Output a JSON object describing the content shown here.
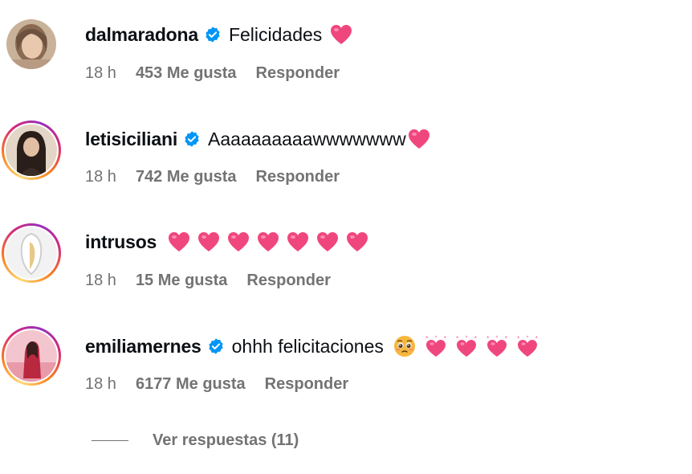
{
  "comments": [
    {
      "username": "dalmaradona",
      "verified": true,
      "text": "Felicidades",
      "emojis": [
        "heart"
      ],
      "time": "18 h",
      "likes": "453 Me gusta",
      "reply_label": "Responder"
    },
    {
      "username": "letisiciliani",
      "verified": true,
      "text": "Aaaaaaaaaawwwwwww",
      "emojis": [
        "heart"
      ],
      "time": "18 h",
      "likes": "742 Me gusta",
      "reply_label": "Responder"
    },
    {
      "username": "intrusos",
      "verified": false,
      "text": "",
      "emojis": [
        "heart",
        "heart",
        "heart",
        "heart",
        "heart",
        "heart",
        "heart"
      ],
      "time": "18 h",
      "likes": "15 Me gusta",
      "reply_label": "Responder"
    },
    {
      "username": "emiliamernes",
      "verified": true,
      "text": "ohhh felicitaciones",
      "emojis": [
        "pleading-face",
        "sparkling-heart",
        "sparkling-heart",
        "sparkling-heart",
        "sparkling-heart"
      ],
      "time": "18 h",
      "likes": "6177 Me gusta",
      "reply_label": "Responder"
    }
  ],
  "view_replies_label": "Ver respuestas (11)",
  "colors": {
    "text_primary": "#0c1014",
    "text_secondary": "#737373",
    "verified_blue": "#0095f6",
    "heart_pink": "#f0467e"
  }
}
